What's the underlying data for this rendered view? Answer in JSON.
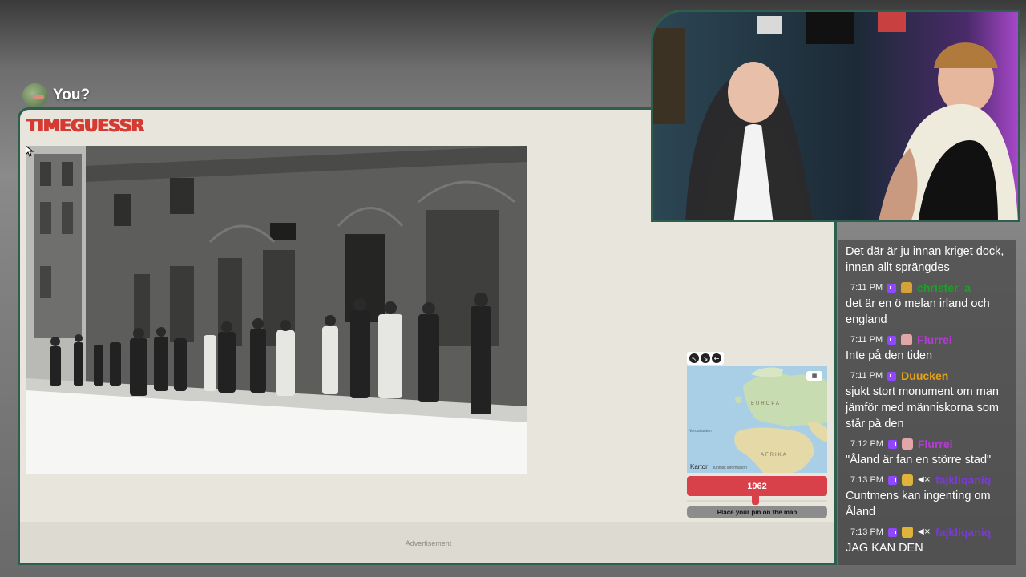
{
  "overlay": {
    "label": "You?"
  },
  "game": {
    "logo_text": "TIMEGUESSR",
    "year_value": "1962",
    "place_pin_label": "Place your pin on the map",
    "ad_label": "Advertisement",
    "map": {
      "label_europe": "EUROPA",
      "label_africa": "AFRIKA",
      "label_ocean": "Nordatlanten",
      "attribution": "Kartor",
      "legal": "Juridisk information",
      "tools": [
        "expand-icon",
        "shrink-icon",
        "back-icon"
      ]
    }
  },
  "chat": {
    "messages": [
      {
        "time": "",
        "user": "",
        "user_color": "#ffffff",
        "badges": [],
        "text": "Det där är ju innan kriget dock, innan allt sprängdes"
      },
      {
        "time": "7:11 PM",
        "user": "christer_a",
        "user_color": "#1e9e28",
        "badges": [
          "#d7a13a"
        ],
        "text": "det är en ö melan irland och england"
      },
      {
        "time": "7:11 PM",
        "user": "Flurrei",
        "user_color": "#b63bd6",
        "badges": [
          "#e3a6a8"
        ],
        "text": "Inte på den tiden"
      },
      {
        "time": "7:11 PM",
        "user": "Duucken",
        "user_color": "#e6a315",
        "badges": [],
        "text": "sjukt stort monument om man jämför med människorna som står på den"
      },
      {
        "time": "7:12 PM",
        "user": "Flurrei",
        "user_color": "#b63bd6",
        "badges": [
          "#e3a6a8"
        ],
        "text": "\"Åland är fan en större stad\""
      },
      {
        "time": "7:13 PM",
        "user": "fajkliqaniq",
        "user_color": "#7a3ad6",
        "badges": [
          "#e0b43a"
        ],
        "muted": true,
        "text": "Cuntmens kan ingenting om Åland"
      },
      {
        "time": "7:13 PM",
        "user": "fajkliqaniq",
        "user_color": "#7a3ad6",
        "badges": [
          "#e0b43a"
        ],
        "muted": true,
        "text": "JAG KAN DEN"
      }
    ]
  },
  "colors": {
    "accent_red": "#d9414a",
    "frame_green": "#2f5e4e",
    "twitch_purple": "#9146ff"
  }
}
